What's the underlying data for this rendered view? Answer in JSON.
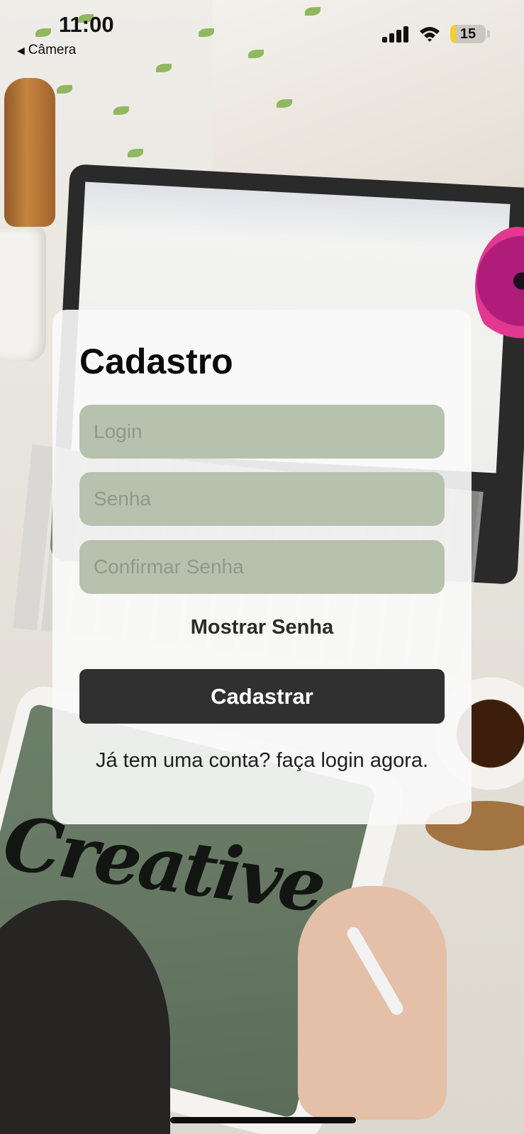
{
  "status_bar": {
    "time": "11:00",
    "back_label": "Câmera",
    "battery_level": "15",
    "battery_fraction": 0.15,
    "battery_color": "#f5cf2a",
    "icons": [
      "back-arrow-icon",
      "cellular-signal-icon",
      "wifi-icon",
      "battery-icon"
    ]
  },
  "form": {
    "title": "Cadastro",
    "login_placeholder": "Login",
    "password_placeholder": "Senha",
    "confirm_placeholder": "Confirmar Senha",
    "login_value": "",
    "password_value": "",
    "confirm_value": "",
    "show_password_label": "Mostrar Senha",
    "submit_label": "Cadastrar",
    "login_link_text": "Já tem uma conta? faça login agora."
  },
  "background": {
    "tablet_lettering": "Creative"
  },
  "colors": {
    "field_background": "#b7c2ae",
    "button_background": "#303030",
    "card_background": "#fafaf9"
  }
}
